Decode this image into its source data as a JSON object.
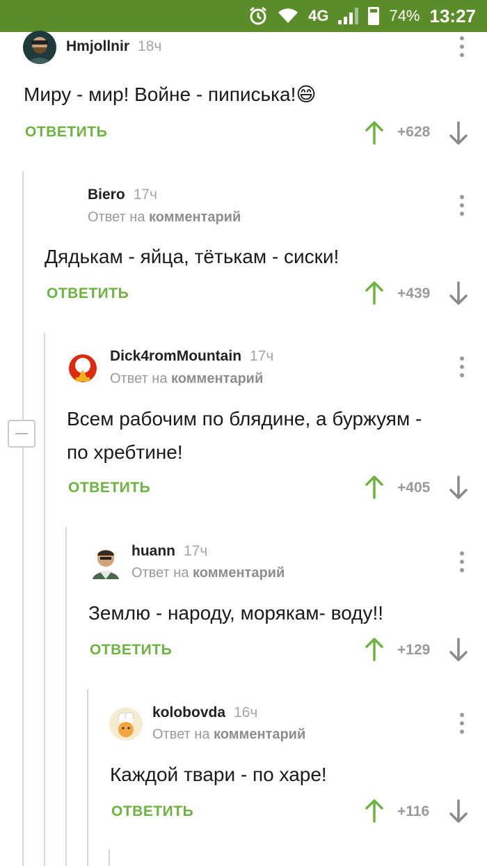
{
  "status_bar": {
    "battery": "74%",
    "time": "13:27",
    "network": "4G",
    "icons": [
      "alarm-icon",
      "wifi-icon",
      "signal-icon",
      "battery-icon"
    ]
  },
  "comments": [
    {
      "user": "Hmjollnir",
      "time": "18ч",
      "reply_to": null,
      "text": "Миру - мир! Войне - пиписька!",
      "emoji": "😄",
      "reply_label": "ОТВЕТИТЬ",
      "votes": "+628"
    },
    {
      "user": "Biero",
      "time": "17ч",
      "reply_prefix": "Ответ на",
      "reply_to": "комментарий",
      "text": "Дядькам - яйца, тётькам - сиски!",
      "reply_label": "ОТВЕТИТЬ",
      "votes": "+439"
    },
    {
      "user": "Dick4romMountain",
      "time": "17ч",
      "reply_prefix": "Ответ на",
      "reply_to": "комментарий",
      "text_line1": "Всем рабочим по блядине, а буржуям -",
      "text_line2": "по хребтине!",
      "reply_label": "ОТВЕТИТЬ",
      "votes": "+405"
    },
    {
      "user": "huann",
      "time": "17ч",
      "reply_prefix": "Ответ на",
      "reply_to": "комментарий",
      "text": "Землю - народу, морякам- воду!!",
      "reply_label": "ОТВЕТИТЬ",
      "votes": "+129"
    },
    {
      "user": "kolobovda",
      "time": "16ч",
      "reply_prefix": "Ответ на",
      "reply_to": "комментарий",
      "text": "Каждой твари - по харе!",
      "reply_label": "ОТВЕТИТЬ",
      "votes": "+116"
    }
  ],
  "colors": {
    "status_bar": "#5b8c2a",
    "accent_green": "#6cb33f",
    "thread_line": "#d6d6d6",
    "muted_text": "#9a9a9a"
  }
}
